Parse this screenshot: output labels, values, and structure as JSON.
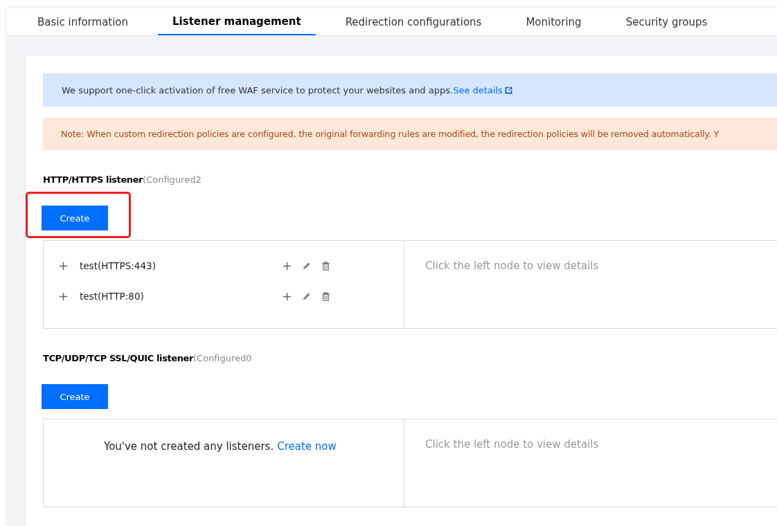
{
  "tabs": [
    {
      "label": "Basic information",
      "selected": false
    },
    {
      "label": "Listener management",
      "selected": true
    },
    {
      "label": "Redirection configurations",
      "selected": false
    },
    {
      "label": "Monitoring",
      "selected": false
    },
    {
      "label": "Security groups",
      "selected": false
    }
  ],
  "notices": [
    {
      "kind": "info",
      "text": "We support one-click activation of free WAF service to protect your websites and apps.",
      "link": "See details"
    },
    {
      "kind": "warning",
      "text": "Note: When custom redirection policies are configured, the original forwarding rules are modified, the redirection policies will be removed automatically. Y"
    }
  ],
  "sections": [
    {
      "title": "HTTP/HTTPS listener",
      "count": "(Configured2",
      "create_button": "Create",
      "highlighted": true,
      "detail_placeholder": "Click the left node to view details",
      "listeners": [
        {
          "name": "test(HTTPS:443)"
        },
        {
          "name": "test(HTTP:80)"
        }
      ]
    },
    {
      "title": "TCP/UDP/TCP SSL/QUIC listener",
      "count": "(Configured0",
      "create_button": "Create",
      "highlighted": false,
      "detail_placeholder": "Click the left node to view details",
      "empty": {
        "text": "You've not created any listeners.",
        "link": "Create now"
      }
    }
  ]
}
